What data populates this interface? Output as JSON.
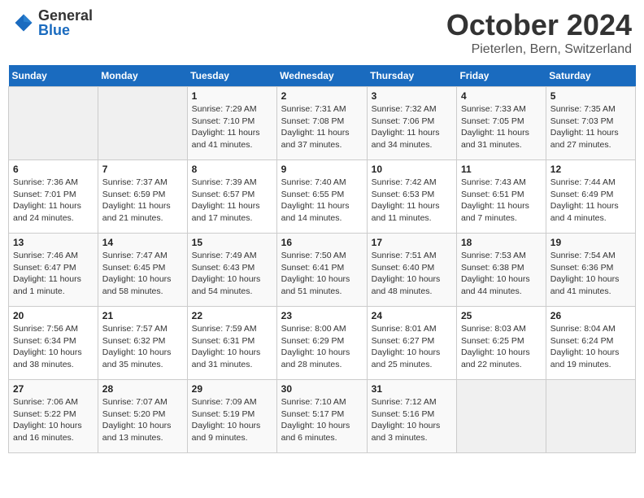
{
  "header": {
    "logo_general": "General",
    "logo_blue": "Blue",
    "month_title": "October 2024",
    "subtitle": "Pieterlen, Bern, Switzerland"
  },
  "days_of_week": [
    "Sunday",
    "Monday",
    "Tuesday",
    "Wednesday",
    "Thursday",
    "Friday",
    "Saturday"
  ],
  "weeks": [
    [
      {
        "day": "",
        "empty": true
      },
      {
        "day": "",
        "empty": true
      },
      {
        "day": "1",
        "sunrise": "7:29 AM",
        "sunset": "7:10 PM",
        "daylight": "11 hours and 41 minutes."
      },
      {
        "day": "2",
        "sunrise": "7:31 AM",
        "sunset": "7:08 PM",
        "daylight": "11 hours and 37 minutes."
      },
      {
        "day": "3",
        "sunrise": "7:32 AM",
        "sunset": "7:06 PM",
        "daylight": "11 hours and 34 minutes."
      },
      {
        "day": "4",
        "sunrise": "7:33 AM",
        "sunset": "7:05 PM",
        "daylight": "11 hours and 31 minutes."
      },
      {
        "day": "5",
        "sunrise": "7:35 AM",
        "sunset": "7:03 PM",
        "daylight": "11 hours and 27 minutes."
      }
    ],
    [
      {
        "day": "6",
        "sunrise": "7:36 AM",
        "sunset": "7:01 PM",
        "daylight": "11 hours and 24 minutes."
      },
      {
        "day": "7",
        "sunrise": "7:37 AM",
        "sunset": "6:59 PM",
        "daylight": "11 hours and 21 minutes."
      },
      {
        "day": "8",
        "sunrise": "7:39 AM",
        "sunset": "6:57 PM",
        "daylight": "11 hours and 17 minutes."
      },
      {
        "day": "9",
        "sunrise": "7:40 AM",
        "sunset": "6:55 PM",
        "daylight": "11 hours and 14 minutes."
      },
      {
        "day": "10",
        "sunrise": "7:42 AM",
        "sunset": "6:53 PM",
        "daylight": "11 hours and 11 minutes."
      },
      {
        "day": "11",
        "sunrise": "7:43 AM",
        "sunset": "6:51 PM",
        "daylight": "11 hours and 7 minutes."
      },
      {
        "day": "12",
        "sunrise": "7:44 AM",
        "sunset": "6:49 PM",
        "daylight": "11 hours and 4 minutes."
      }
    ],
    [
      {
        "day": "13",
        "sunrise": "7:46 AM",
        "sunset": "6:47 PM",
        "daylight": "11 hours and 1 minute."
      },
      {
        "day": "14",
        "sunrise": "7:47 AM",
        "sunset": "6:45 PM",
        "daylight": "10 hours and 58 minutes."
      },
      {
        "day": "15",
        "sunrise": "7:49 AM",
        "sunset": "6:43 PM",
        "daylight": "10 hours and 54 minutes."
      },
      {
        "day": "16",
        "sunrise": "7:50 AM",
        "sunset": "6:41 PM",
        "daylight": "10 hours and 51 minutes."
      },
      {
        "day": "17",
        "sunrise": "7:51 AM",
        "sunset": "6:40 PM",
        "daylight": "10 hours and 48 minutes."
      },
      {
        "day": "18",
        "sunrise": "7:53 AM",
        "sunset": "6:38 PM",
        "daylight": "10 hours and 44 minutes."
      },
      {
        "day": "19",
        "sunrise": "7:54 AM",
        "sunset": "6:36 PM",
        "daylight": "10 hours and 41 minutes."
      }
    ],
    [
      {
        "day": "20",
        "sunrise": "7:56 AM",
        "sunset": "6:34 PM",
        "daylight": "10 hours and 38 minutes."
      },
      {
        "day": "21",
        "sunrise": "7:57 AM",
        "sunset": "6:32 PM",
        "daylight": "10 hours and 35 minutes."
      },
      {
        "day": "22",
        "sunrise": "7:59 AM",
        "sunset": "6:31 PM",
        "daylight": "10 hours and 31 minutes."
      },
      {
        "day": "23",
        "sunrise": "8:00 AM",
        "sunset": "6:29 PM",
        "daylight": "10 hours and 28 minutes."
      },
      {
        "day": "24",
        "sunrise": "8:01 AM",
        "sunset": "6:27 PM",
        "daylight": "10 hours and 25 minutes."
      },
      {
        "day": "25",
        "sunrise": "8:03 AM",
        "sunset": "6:25 PM",
        "daylight": "10 hours and 22 minutes."
      },
      {
        "day": "26",
        "sunrise": "8:04 AM",
        "sunset": "6:24 PM",
        "daylight": "10 hours and 19 minutes."
      }
    ],
    [
      {
        "day": "27",
        "sunrise": "7:06 AM",
        "sunset": "5:22 PM",
        "daylight": "10 hours and 16 minutes."
      },
      {
        "day": "28",
        "sunrise": "7:07 AM",
        "sunset": "5:20 PM",
        "daylight": "10 hours and 13 minutes."
      },
      {
        "day": "29",
        "sunrise": "7:09 AM",
        "sunset": "5:19 PM",
        "daylight": "10 hours and 9 minutes."
      },
      {
        "day": "30",
        "sunrise": "7:10 AM",
        "sunset": "5:17 PM",
        "daylight": "10 hours and 6 minutes."
      },
      {
        "day": "31",
        "sunrise": "7:12 AM",
        "sunset": "5:16 PM",
        "daylight": "10 hours and 3 minutes."
      },
      {
        "day": "",
        "empty": true
      },
      {
        "day": "",
        "empty": true
      }
    ]
  ],
  "labels": {
    "sunrise": "Sunrise:",
    "sunset": "Sunset:",
    "daylight": "Daylight:"
  }
}
